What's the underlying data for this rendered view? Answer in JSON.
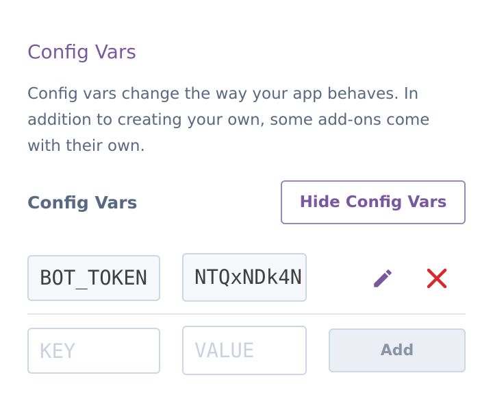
{
  "section": {
    "title": "Config Vars",
    "description": "Config vars change the way your app behaves. In addition to creating your own, some add-ons come with their own."
  },
  "vars": {
    "heading": "Config Vars",
    "toggle_label": "Hide Config Vars",
    "entries": [
      {
        "key": "BOT_TOKEN",
        "value": "NTQxNDk4N"
      }
    ],
    "new_entry": {
      "key_placeholder": "KEY",
      "value_placeholder": "VALUE",
      "add_label": "Add"
    }
  },
  "icons": {
    "edit": "pencil-icon",
    "delete": "close-icon"
  },
  "colors": {
    "accent": "#79589f",
    "text": "#596981",
    "delete": "#d8282b",
    "border": "#cfd7e6"
  }
}
